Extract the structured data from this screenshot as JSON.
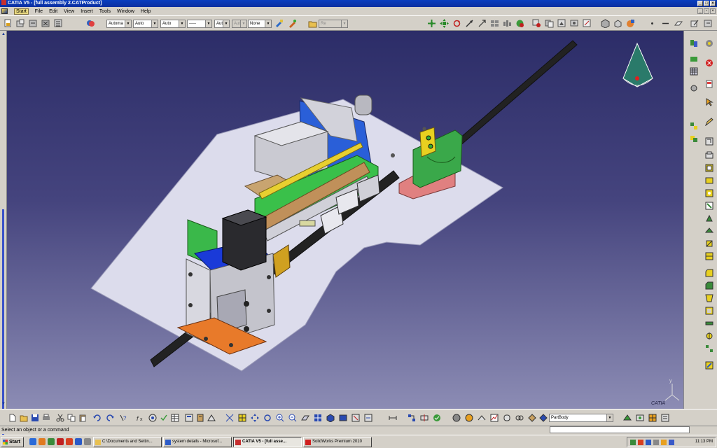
{
  "window": {
    "title": "CATIA V5 - [full assembly 2.CATProduct]"
  },
  "menu": [
    "Start",
    "File",
    "Edit",
    "View",
    "Insert",
    "Tools",
    "Window",
    "Help"
  ],
  "toolbar_combos": {
    "color": "Automa",
    "transparency": "Auto",
    "line_thickness": "Auto",
    "line_type": "-----",
    "point_type": "Aut",
    "layer_disabled": "Aut",
    "layer": "None",
    "filter": "Re"
  },
  "partbody_combo": "PartBody",
  "status": {
    "message": "Select an object or a command"
  },
  "taskbar": {
    "start": "Start",
    "tasks": [
      {
        "label": "C:\\Documents and Settin...",
        "icon": "#e8c050"
      },
      {
        "label": "system details - Microsof...",
        "icon": "#2e5cc8"
      },
      {
        "label": "CATIA V5 - [full asse...",
        "icon": "#c62f2f",
        "active": true
      },
      {
        "label": "SolidWorks Premium 2010",
        "icon": "#d02020"
      }
    ],
    "clock": "11:13 PM"
  },
  "compass_label": "y",
  "logo_text": "CATIA"
}
